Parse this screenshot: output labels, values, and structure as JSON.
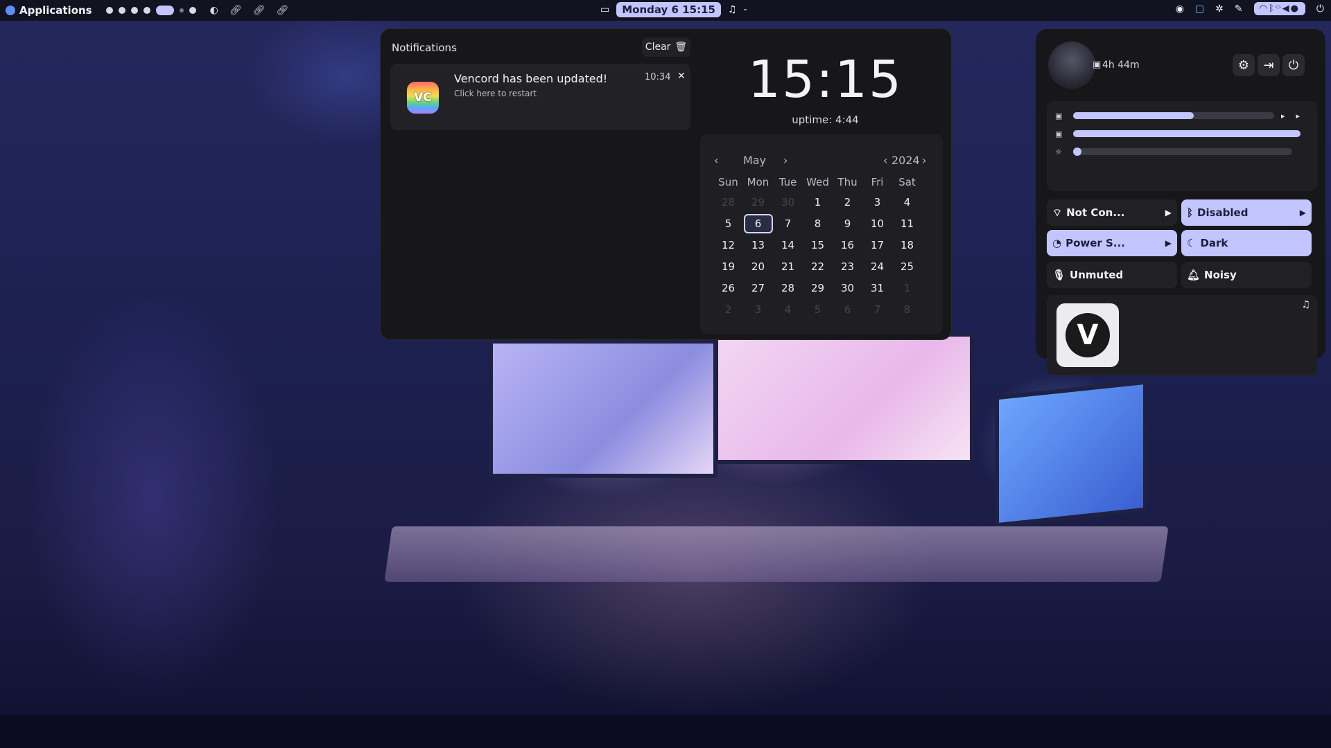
{
  "topbar": {
    "apps_label": "Applications",
    "clock": "Monday  6  15:15",
    "music_sep": "-"
  },
  "notifications": {
    "header": "Notifications",
    "clear_label": "Clear",
    "items": [
      {
        "title": "Vencord has been updated!",
        "body": "Click here to restart",
        "time": "10:34",
        "icon_text": "VC"
      }
    ]
  },
  "clock": {
    "time": "15:15",
    "uptime": "uptime: 4:44"
  },
  "calendar": {
    "month": "May",
    "year": "2024",
    "weekdays": [
      "Sun",
      "Mon",
      "Tue",
      "Wed",
      "Thu",
      "Fri",
      "Sat"
    ],
    "days": [
      [
        "28",
        "29",
        "30",
        "1",
        "2",
        "3",
        "4"
      ],
      [
        "5",
        "6",
        "7",
        "8",
        "9",
        "10",
        "11"
      ],
      [
        "12",
        "13",
        "14",
        "15",
        "16",
        "17",
        "18"
      ],
      [
        "19",
        "20",
        "21",
        "22",
        "23",
        "24",
        "25"
      ],
      [
        "26",
        "27",
        "28",
        "29",
        "30",
        "31",
        "1"
      ],
      [
        "2",
        "3",
        "4",
        "5",
        "6",
        "7",
        "8"
      ]
    ],
    "today": "6"
  },
  "quick_settings": {
    "battery_time": "4h 44m",
    "sliders": [
      {
        "name": "speaker-volume",
        "value": 0.6,
        "icon": "speaker-icon"
      },
      {
        "name": "mic-volume",
        "value": 1.0,
        "icon": "mic-icon"
      },
      {
        "name": "brightness",
        "value": 0.0,
        "icon": "brightness-icon"
      }
    ],
    "tiles": {
      "network": "Not Con...",
      "bluetooth": "Disabled",
      "power": "Power S...",
      "theme": "Dark",
      "mic": "Unmuted",
      "notifications": "Noisy"
    },
    "accent_color": "#c3c5ff"
  }
}
